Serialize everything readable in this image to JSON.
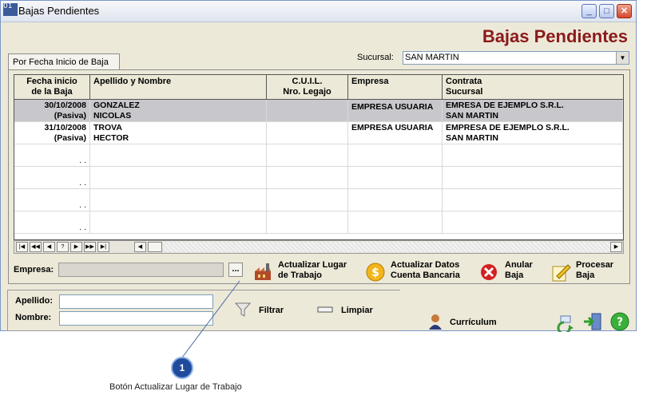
{
  "window": {
    "icon_text": "01",
    "title": "Bajas Pendientes",
    "heading": "Bajas Pendientes"
  },
  "tab": {
    "label": "Por Fecha Inicio de Baja"
  },
  "sucursal": {
    "label": "Sucursal:",
    "value": "SAN MARTIN"
  },
  "table": {
    "headers": [
      [
        "Fecha inicio",
        "de la Baja"
      ],
      [
        "Apellido y Nombre",
        ""
      ],
      [
        "C.U.I.L.",
        "Nro. Legajo"
      ],
      [
        "Empresa",
        ""
      ],
      [
        "Contrata",
        "Sucursal"
      ]
    ],
    "rows": [
      {
        "fecha": "30/10/2008",
        "estado": "(Pasiva)",
        "apellido": "GONZALEZ",
        "nombre": "NICOLAS",
        "cuil": "",
        "legajo": "",
        "empresa": "EMPRESA USUARIA",
        "contrata": "EMRESA DE EJEMPLO S.R.L.",
        "sucursal": "SAN MARTIN"
      },
      {
        "fecha": "31/10/2008",
        "estado": "(Pasiva)",
        "apellido": "TROVA",
        "nombre": "HECTOR",
        "cuil": "",
        "legajo": "",
        "empresa": "EMPRESA USUARIA",
        "contrata": "EMPRESA DE EJEMPLO S.R.L.",
        "sucursal": "SAN MARTIN"
      }
    ],
    "empty_row_marks": [
      ". .",
      ". .",
      ". .",
      ". ."
    ]
  },
  "navigator": {
    "buttons": [
      "|◀",
      "◀◀",
      "◀",
      "?",
      "▶",
      "▶▶",
      "▶|"
    ]
  },
  "empresa_field": {
    "label": "Empresa:",
    "value": "",
    "browse_label": "..."
  },
  "actions": {
    "actualizar_lugar": [
      "Actualizar Lugar",
      "de Trabajo"
    ],
    "actualizar_datos": [
      "Actualizar Datos",
      "Cuenta Bancaria"
    ],
    "anular": [
      "Anular",
      "Baja"
    ],
    "procesar": [
      "Procesar",
      "Baja"
    ]
  },
  "filter": {
    "apellido_label": "Apellido:",
    "nombre_label": "Nombre:",
    "apellido_value": "",
    "nombre_value": "",
    "filtrar_label": "Filtrar",
    "limpiar_label": "Limpiar"
  },
  "bottom": {
    "curriculum_label": "Currículum"
  },
  "callout": {
    "number": "1",
    "caption": "Botón Actualizar Lugar de Trabajo"
  },
  "colors": {
    "heading": "#8b1a1a",
    "selected_row": "#c8c8cc",
    "badge": "#1f4b9c"
  }
}
